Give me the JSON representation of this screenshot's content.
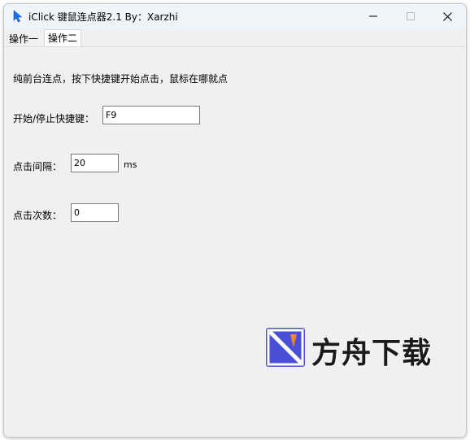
{
  "window": {
    "title": "iClick 键鼠连点器2.1 By：Xarzhi",
    "icon": "cursor-arrow-icon",
    "controls": [
      "minimize-icon",
      "maximize-icon",
      "close-icon"
    ]
  },
  "tabs": [
    {
      "label": "操作一",
      "selected": false
    },
    {
      "label": "操作二",
      "selected": true
    }
  ],
  "panel": {
    "description": "纯前台连点，按下快捷键开始点击，鼠标在哪就点",
    "hotkey": {
      "label": "开始/停止快捷键：",
      "value": "F9"
    },
    "interval": {
      "label": "点击间隔：",
      "value": "20",
      "unit": "ms"
    },
    "count": {
      "label": "点击次数：",
      "value": "0"
    }
  },
  "watermark": {
    "text": "方舟下载",
    "icon": "fangzhou-logo-icon"
  },
  "colors": {
    "accent": "#1a73e8",
    "watermark_blue": "#4b4fd8",
    "watermark_orange": "#f08a1c"
  }
}
